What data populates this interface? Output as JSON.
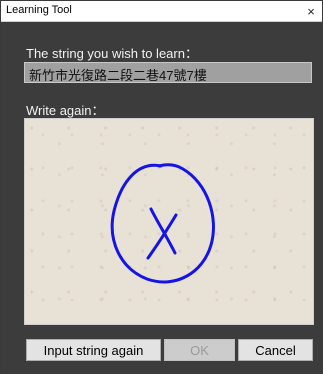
{
  "window": {
    "title": "Learning Tool",
    "close_glyph": "×"
  },
  "prompt": {
    "label": "The string you wish to learn：",
    "value": "新竹市光復路二段二巷47號7樓"
  },
  "writing_area": {
    "label": "Write again：",
    "stroke_color": "#1414e6",
    "background_color": "#e8e1d6"
  },
  "buttons": {
    "input_again": "Input string again",
    "ok": "OK",
    "cancel": "Cancel"
  }
}
